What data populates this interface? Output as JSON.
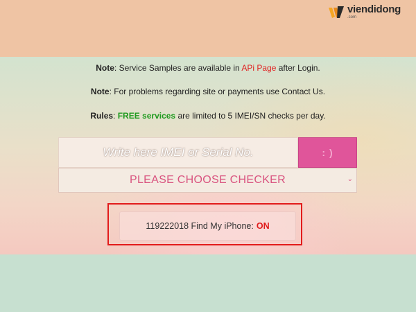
{
  "brand": {
    "name": "viendidong",
    "sub": ".com",
    "colors": {
      "accent_orange": "#f5a623",
      "accent_dark": "#2b2b2b"
    }
  },
  "notes": {
    "line1": {
      "label": "Note",
      "pre": ": Service Samples are available in ",
      "link": "APi Page",
      "post": " after Login."
    },
    "line2": {
      "label": "Note",
      "text": ": For problems regarding site or payments use Contact Us."
    },
    "line3": {
      "label": "Rules",
      "pre": ": ",
      "highlight": "FREE services",
      "post": " are limited to 5 IMEI/SN checks per day."
    }
  },
  "imei_input": {
    "placeholder": "Write here IMEI or Serial No.",
    "value": ""
  },
  "submit": {
    "icon": "smile-icon",
    "glyph": ": )"
  },
  "checker": {
    "selected": "PLEASE CHOOSE CHECKER",
    "icon": "chevron-down-icon"
  },
  "result": {
    "text": "119222018 Find My iPhone:",
    "status": "ON",
    "status_color": "#e01b1b"
  },
  "colors": {
    "top_band": "#efc4a4",
    "bottom_band": "#c7e0d0",
    "submit_button": "#e0559a",
    "checker_text": "#d9537f",
    "link_red": "#e02020",
    "free_green": "#1f9a1f",
    "highlight_border": "#e21b1b"
  }
}
